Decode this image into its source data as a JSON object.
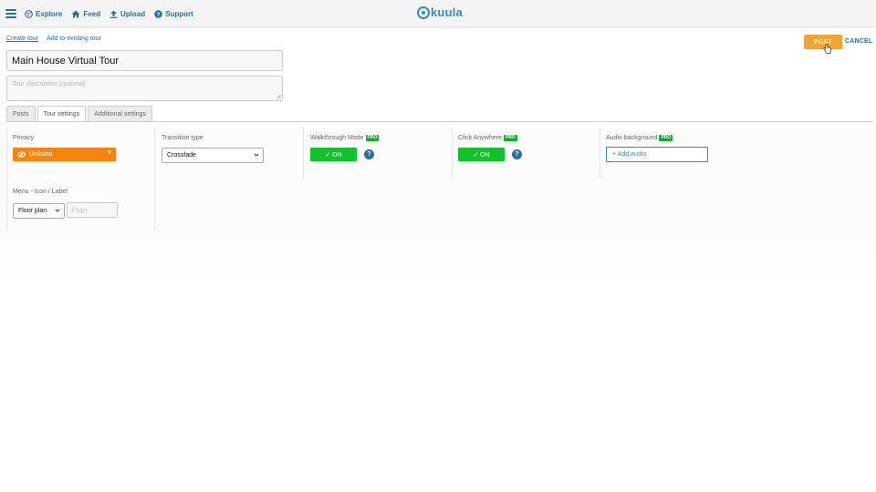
{
  "nav": {
    "items": [
      {
        "label": "Explore",
        "icon": "globe-icon"
      },
      {
        "label": "Feed",
        "icon": "home-icon"
      },
      {
        "label": "Upload",
        "icon": "upload-icon"
      },
      {
        "label": "Support",
        "icon": "question-icon"
      }
    ],
    "logo_text": "kuula"
  },
  "breadcrumbs": {
    "create_tour": "Create tour",
    "add_existing": "Add to existing tour"
  },
  "actions": {
    "post_label": "POST",
    "cancel_label": "CANCEL"
  },
  "tour": {
    "title": "Main House Virtual Tour",
    "description_placeholder": "Tour description (optional)"
  },
  "tabs": [
    {
      "label": "Posts",
      "active": false
    },
    {
      "label": "Tour settings",
      "active": true
    },
    {
      "label": "Additional settings",
      "active": false
    }
  ],
  "settings": {
    "privacy": {
      "label": "Privacy",
      "value": "Unlisted",
      "arrow": "▼"
    },
    "transition": {
      "label": "Transition type",
      "value": "Crossfade"
    },
    "walkthrough": {
      "label": "Walkthrough Mode",
      "badge": "PRO",
      "toggle": "✓ ON",
      "help": "?"
    },
    "click_anywhere": {
      "label": "Click Anywhere",
      "badge": "PRO",
      "toggle": "✓ ON",
      "help": "?"
    },
    "audio": {
      "label": "Audio background",
      "badge": "PRO",
      "button": "+ Add audio"
    }
  },
  "menu": {
    "label": "Menu - Icon / Label",
    "icon_select": "Floor plan",
    "label_placeholder": "Plan"
  },
  "colors": {
    "accent_blue": "#2b6ea1",
    "post_orange": "#f5a331",
    "privacy_orange": "#f5850f",
    "toggle_green": "#12c12b",
    "pro_green": "#1aa832"
  }
}
